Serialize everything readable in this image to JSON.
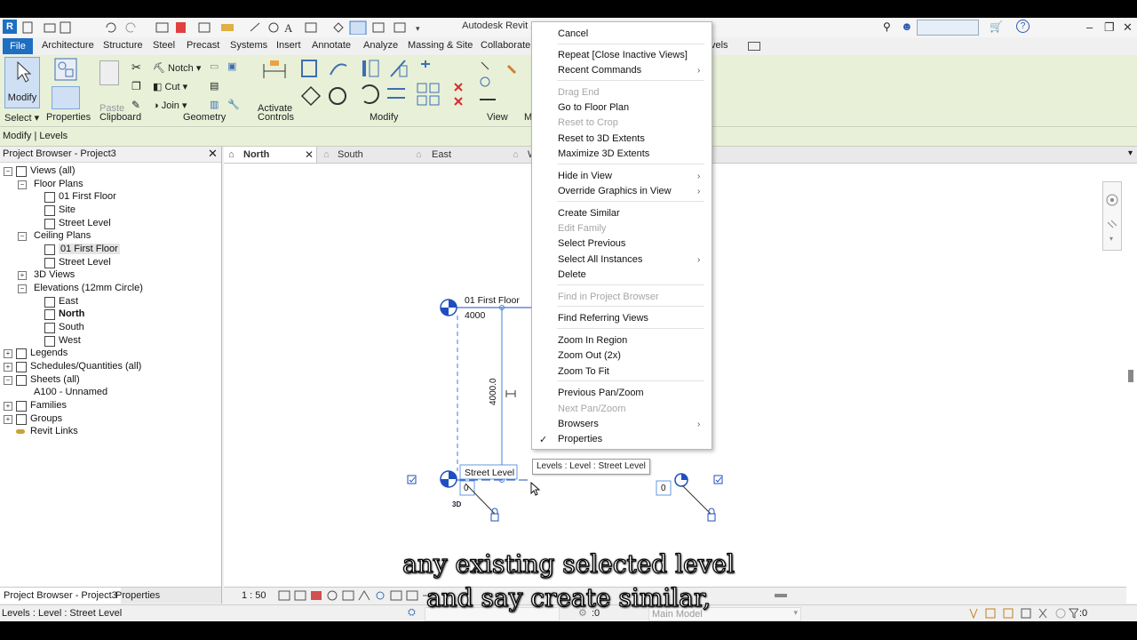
{
  "window": {
    "title": "Autodesk Revit 2023 - Project3 - Elevation: North",
    "app_badge": "R"
  },
  "ribbon_tabs": [
    "Architecture",
    "Structure",
    "Steel",
    "Precast",
    "Systems",
    "Insert",
    "Annotate",
    "Analyze",
    "Massing & Site",
    "Collaborate"
  ],
  "ribbon_tab_partial": "vels",
  "file_tab": "File",
  "ribbon": {
    "modify_label": "Modify",
    "select_label": "Select",
    "properties_label": "Properties",
    "paste_label": "Paste",
    "clipboard_label": "Clipboard",
    "notch_label": "Notch",
    "cut_label": "Cut",
    "join_label": "Join",
    "geometry_label": "Geometry",
    "activate_label": "Activate",
    "controls_label": "Controls",
    "modify_panel_label": "Modify",
    "view_panel_label": "View",
    "partial_panel_label": "M"
  },
  "context_bar": {
    "text": "Modify | Levels"
  },
  "project_browser": {
    "title": "Project Browser - Project3",
    "items": [
      {
        "label": "Views (all)",
        "level": 0,
        "expander": "-",
        "icon": "views-icon"
      },
      {
        "label": "Floor Plans",
        "level": 1,
        "expander": "-"
      },
      {
        "label": "01 First Floor",
        "level": 2,
        "icon": "view-icon"
      },
      {
        "label": "Site",
        "level": 2,
        "icon": "view-icon"
      },
      {
        "label": "Street Level",
        "level": 2,
        "icon": "view-icon"
      },
      {
        "label": "Ceiling Plans",
        "level": 1,
        "expander": "-"
      },
      {
        "label": "01 First Floor",
        "level": 2,
        "icon": "view-icon",
        "highlight": true
      },
      {
        "label": "Street Level",
        "level": 2,
        "icon": "view-icon"
      },
      {
        "label": "3D Views",
        "level": 1,
        "expander": "+"
      },
      {
        "label": "Elevations (12mm Circle)",
        "level": 1,
        "expander": "-"
      },
      {
        "label": "East",
        "level": 2,
        "icon": "view-icon"
      },
      {
        "label": "North",
        "level": 2,
        "icon": "view-icon",
        "bold": true
      },
      {
        "label": "South",
        "level": 2,
        "icon": "view-icon"
      },
      {
        "label": "West",
        "level": 2,
        "icon": "view-icon"
      },
      {
        "label": "Legends",
        "level": 0,
        "expander": "+",
        "icon": "legend-icon"
      },
      {
        "label": "Schedules/Quantities (all)",
        "level": 0,
        "expander": "+",
        "icon": "schedule-icon"
      },
      {
        "label": "Sheets (all)",
        "level": 0,
        "expander": "-",
        "icon": "sheet-icon"
      },
      {
        "label": "A100 - Unnamed",
        "level": 1
      },
      {
        "label": "Families",
        "level": 0,
        "expander": "+",
        "icon": "family-icon"
      },
      {
        "label": "Groups",
        "level": 0,
        "expander": "+",
        "icon": "group-icon"
      },
      {
        "label": "Revit Links",
        "level": 0,
        "icon": "link-icon"
      }
    ]
  },
  "view_tabs": [
    {
      "label": "North",
      "active": true
    },
    {
      "label": "South"
    },
    {
      "label": "East"
    },
    {
      "label": "W"
    }
  ],
  "canvas": {
    "level_top_name": "01 First Floor",
    "level_top_elev": "4000",
    "dim_text": "4000.0",
    "level_bottom_name": "Street Level",
    "level_bottom_elev": "0",
    "level_bottom_elev_right": "0",
    "label_3d": "3D"
  },
  "context_menu": {
    "items": [
      {
        "label": "Cancel"
      },
      {
        "sep": true
      },
      {
        "label": "Repeat [Close Inactive Views]"
      },
      {
        "label": "Recent Commands",
        "submenu": true
      },
      {
        "sep": true
      },
      {
        "label": "Drag End",
        "disabled": true
      },
      {
        "label": "Go to Floor Plan"
      },
      {
        "label": "Reset to Crop",
        "disabled": true
      },
      {
        "label": "Reset to 3D Extents"
      },
      {
        "label": "Maximize 3D Extents"
      },
      {
        "sep": true
      },
      {
        "label": "Hide in View",
        "submenu": true
      },
      {
        "label": "Override Graphics in View",
        "submenu": true
      },
      {
        "sep": true
      },
      {
        "label": "Create Similar"
      },
      {
        "label": "Edit Family",
        "disabled": true
      },
      {
        "label": "Select Previous"
      },
      {
        "label": "Select All Instances",
        "submenu": true
      },
      {
        "label": "Delete"
      },
      {
        "sep": true
      },
      {
        "label": "Find in Project Browser",
        "disabled": true
      },
      {
        "sep": true
      },
      {
        "label": "Find Referring Views"
      },
      {
        "sep": true
      },
      {
        "label": "Zoom In Region"
      },
      {
        "label": "Zoom Out (2x)"
      },
      {
        "label": "Zoom To Fit"
      },
      {
        "sep": true
      },
      {
        "label": "Previous Pan/Zoom"
      },
      {
        "label": "Next Pan/Zoom",
        "disabled": true
      },
      {
        "label": "Browsers",
        "submenu": true
      },
      {
        "label": "Properties",
        "checked": true
      }
    ]
  },
  "tooltip": {
    "text": "Levels : Level : Street Level"
  },
  "bottom_tabs": [
    "Project Browser - Project3",
    "Properties"
  ],
  "view_control": {
    "scale": "1 : 50"
  },
  "status_bar": {
    "text": "Levels : Level : Street Level",
    "zero_left": ":0",
    "model": "Main Model",
    "filter_count": ":0"
  },
  "subtitles": [
    "any existing selected level",
    "and say create similar,"
  ],
  "colors": {
    "ribbon_bg": "#e8f0d8",
    "accent_blue": "#1e6fc2",
    "level_blue": "#1f4fbf",
    "dim_blue": "#3f7fd6"
  }
}
